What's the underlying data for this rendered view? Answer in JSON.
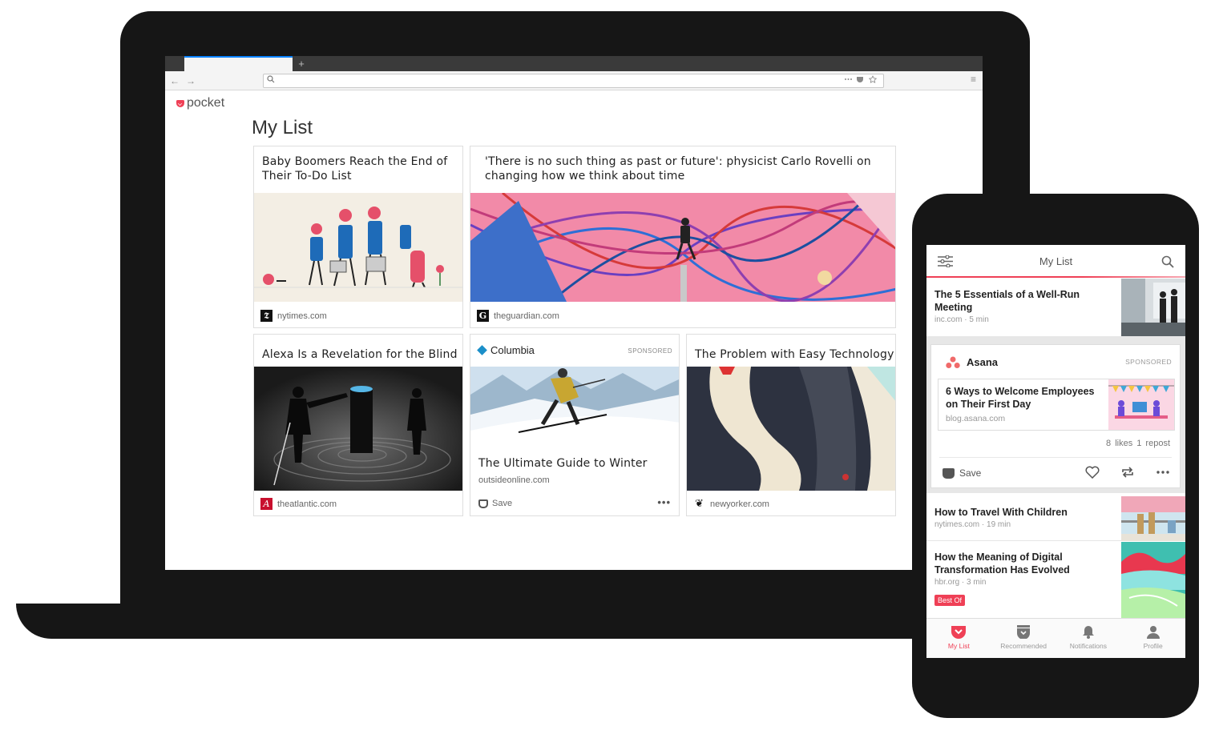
{
  "browser": {
    "new_tab_label": "+",
    "back_icon": "←",
    "forward_icon": "→",
    "url_value": "",
    "menu_icon": "≡"
  },
  "desktop": {
    "logo_text": "pocket",
    "page_title": "My List",
    "cards": [
      {
        "title": "Baby Boomers Reach the End of Their To-Do List",
        "source": "nytimes.com",
        "favicon": "𝕿"
      },
      {
        "title": "'There is no such thing as past or future': physicist Carlo Rovelli on changing how we think about time",
        "source": "theguardian.com",
        "favicon": "G"
      },
      {
        "title": "Alexa Is a Revelation for the Blind",
        "source": "theatlantic.com",
        "favicon": "A"
      },
      {
        "brand": "Columbia",
        "sponsored_label": "SPONSORED",
        "title": "The Ultimate Guide to Winter",
        "source": "outsideonline.com",
        "save_label": "Save",
        "more": "•••"
      },
      {
        "title": "The Problem with Easy Technology",
        "source": "newyorker.com",
        "favicon": "❦"
      }
    ]
  },
  "mobile": {
    "title": "My List",
    "items": [
      {
        "title": "The 5 Essentials of a Well-Run Meeting",
        "meta": "inc.com · 5 min"
      },
      {
        "title": "How to Travel With Children",
        "meta": "nytimes.com · 19 min"
      },
      {
        "title": "How the Meaning of Digital Transformation Has Evolved",
        "meta": "hbr.org · 3 min",
        "badge": "Best Of"
      }
    ],
    "sponsored": {
      "brand": "Asana",
      "label": "SPONSORED",
      "article_title": "6 Ways to Welcome Employees on Their First Day",
      "article_source": "blog.asana.com",
      "engagement": "8 likes  1 repost",
      "save_label": "Save"
    },
    "tabs": [
      {
        "label": "My List"
      },
      {
        "label": "Recommended"
      },
      {
        "label": "Notifications"
      },
      {
        "label": "Profile"
      }
    ]
  },
  "colors": {
    "accent": "#ef4056",
    "device": "#161616",
    "columbia": "#1b8fc9"
  }
}
